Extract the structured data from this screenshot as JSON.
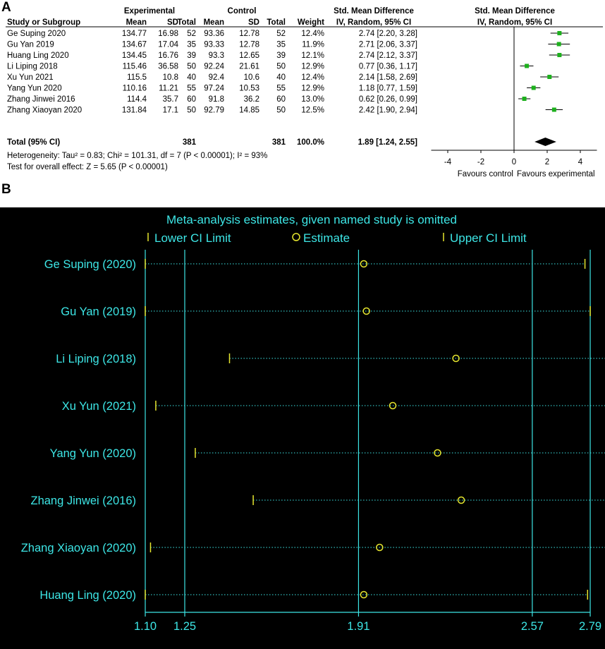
{
  "chart_data": [
    {
      "type": "forest",
      "panel_label": "A",
      "header": {
        "experimental_group": "Experimental",
        "control_group": "Control",
        "smd_title": "Std. Mean Difference",
        "plot_title": "Std. Mean Difference",
        "smd_method": "IV, Random, 95% CI",
        "plot_method": "IV, Random, 95% CI"
      },
      "columns": [
        "Study or Subgroup",
        "Mean",
        "SD",
        "Total",
        "Mean",
        "SD",
        "Total",
        "Weight"
      ],
      "studies": [
        {
          "name": "Ge Suping 2020",
          "e_mean": "134.77",
          "e_sd": "16.98",
          "e_total": "52",
          "c_mean": "93.36",
          "c_sd": "12.78",
          "c_total": "52",
          "weight": "12.4%",
          "ci_text": "2.74 [2.20, 3.28]",
          "smd": 2.74,
          "low": 2.2,
          "high": 3.28
        },
        {
          "name": "Gu Yan 2019",
          "e_mean": "134.67",
          "e_sd": "17.04",
          "e_total": "35",
          "c_mean": "93.33",
          "c_sd": "12.78",
          "c_total": "35",
          "weight": "11.9%",
          "ci_text": "2.71 [2.06, 3.37]",
          "smd": 2.71,
          "low": 2.06,
          "high": 3.37
        },
        {
          "name": "Huang Ling 2020",
          "e_mean": "134.45",
          "e_sd": "16.76",
          "e_total": "39",
          "c_mean": "93.3",
          "c_sd": "12.65",
          "c_total": "39",
          "weight": "12.1%",
          "ci_text": "2.74 [2.12, 3.37]",
          "smd": 2.74,
          "low": 2.12,
          "high": 3.37
        },
        {
          "name": "Li Liping 2018",
          "e_mean": "115.46",
          "e_sd": "36.58",
          "e_total": "50",
          "c_mean": "92.24",
          "c_sd": "21.61",
          "c_total": "50",
          "weight": "12.9%",
          "ci_text": "0.77 [0.36, 1.17]",
          "smd": 0.77,
          "low": 0.36,
          "high": 1.17
        },
        {
          "name": "Xu Yun 2021",
          "e_mean": "115.5",
          "e_sd": "10.8",
          "e_total": "40",
          "c_mean": "92.4",
          "c_sd": "10.6",
          "c_total": "40",
          "weight": "12.4%",
          "ci_text": "2.14 [1.58, 2.69]",
          "smd": 2.14,
          "low": 1.58,
          "high": 2.69
        },
        {
          "name": "Yang Yun 2020",
          "e_mean": "110.16",
          "e_sd": "11.21",
          "e_total": "55",
          "c_mean": "97.24",
          "c_sd": "10.53",
          "c_total": "55",
          "weight": "12.9%",
          "ci_text": "1.18 [0.77, 1.59]",
          "smd": 1.18,
          "low": 0.77,
          "high": 1.59
        },
        {
          "name": "Zhang Jinwei 2016",
          "e_mean": "114.4",
          "e_sd": "35.7",
          "e_total": "60",
          "c_mean": "91.8",
          "c_sd": "36.2",
          "c_total": "60",
          "weight": "13.0%",
          "ci_text": "0.62 [0.26, 0.99]",
          "smd": 0.62,
          "low": 0.26,
          "high": 0.99
        },
        {
          "name": "Zhang Xiaoyan 2020",
          "e_mean": "131.84",
          "e_sd": "17.1",
          "e_total": "50",
          "c_mean": "92.79",
          "c_sd": "14.85",
          "c_total": "50",
          "weight": "12.5%",
          "ci_text": "2.42 [1.90, 2.94]",
          "smd": 2.42,
          "low": 1.9,
          "high": 2.94
        }
      ],
      "total": {
        "label": "Total (95% CI)",
        "e_total": "381",
        "c_total": "381",
        "weight": "100.0%",
        "ci_text": "1.89 [1.24, 2.55]",
        "smd": 1.89,
        "low": 1.24,
        "high": 2.55
      },
      "heterogeneity": "Heterogeneity: Tau² = 0.83; Chi² = 101.31, df = 7 (P < 0.00001); I² = 93%",
      "overall_effect": "Test for overall effect: Z = 5.65 (P < 0.00001)",
      "axis": {
        "ticks": [
          -4,
          -2,
          0,
          2,
          4
        ],
        "tick_labels": [
          "-4",
          "-2",
          "0",
          "2",
          "4"
        ],
        "xlim": [
          -5,
          5
        ]
      },
      "favours_left": "Favours control",
      "favours_right": "Favours experimental",
      "colors": {
        "point": "#1db01d",
        "diamond": "#000000"
      }
    },
    {
      "type": "sensitivity",
      "panel_label": "B",
      "title": "Meta-analysis estimates, given named study is omitted",
      "legend": [
        {
          "symbol": "|",
          "label": "Lower CI Limit"
        },
        {
          "symbol": "o",
          "label": "Estimate"
        },
        {
          "symbol": "|",
          "label": "Upper CI Limit"
        }
      ],
      "studies": [
        {
          "name": "Ge Suping",
          "year": "(2020)",
          "low": 1.1,
          "estimate": 1.93,
          "high": 2.77
        },
        {
          "name": "Gu Yan",
          "year": "(2019)",
          "low": 1.1,
          "estimate": 1.94,
          "high": 2.79
        },
        {
          "name": "Li Liping",
          "year": "(2018)",
          "low": 1.42,
          "estimate": 2.28,
          "high": 3.13
        },
        {
          "name": "Xu Yun",
          "year": "(2021)",
          "low": 1.14,
          "estimate": 2.04,
          "high": 2.95
        },
        {
          "name": "Yang Yun",
          "year": "(2020)",
          "low": 1.29,
          "estimate": 2.21,
          "high": 3.13
        },
        {
          "name": "Zhang Jinwei",
          "year": "(2016)",
          "low": 1.51,
          "estimate": 2.3,
          "high": 3.08
        },
        {
          "name": "Zhang Xiaoyan",
          "year": "(2020)",
          "low": 1.12,
          "estimate": 1.99,
          "high": 2.88
        },
        {
          "name": "Huang Ling",
          "year": "(2020)",
          "low": 1.1,
          "estimate": 1.93,
          "high": 2.78
        }
      ],
      "axis": {
        "ticks": [
          1.1,
          1.25,
          1.91,
          2.57,
          2.79
        ],
        "tick_labels": [
          "1.10",
          "1.25",
          "1.91",
          "2.57",
          "2.79"
        ],
        "xlim": [
          1.1,
          2.79
        ]
      },
      "colors": {
        "background": "#000000",
        "axis": "#3de6e6",
        "marker": "#e6e62e"
      }
    }
  ]
}
